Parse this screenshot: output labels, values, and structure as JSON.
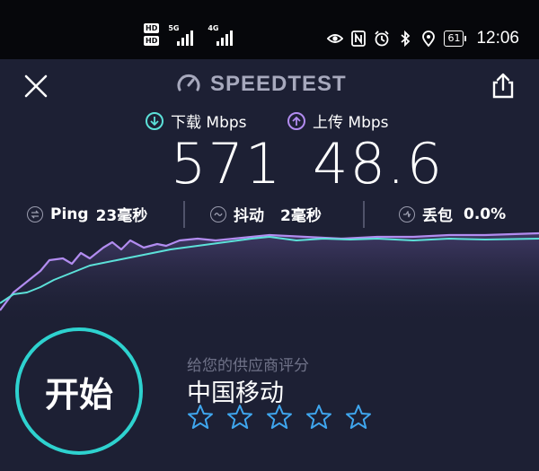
{
  "status_bar": {
    "hd_labels": [
      "HD",
      "HD"
    ],
    "network_labels": [
      "5G",
      "4G"
    ],
    "battery": "61",
    "time": "12:06",
    "icons": [
      "eye-icon",
      "nfc-icon",
      "alarm-icon",
      "bluetooth-icon",
      "location-icon"
    ]
  },
  "header": {
    "brand": "SPEEDTEST",
    "close_icon": "close-icon",
    "share_icon": "share-icon"
  },
  "results": {
    "download": {
      "label": "下载 Mbps",
      "value": "571",
      "color": "#5ce1d9"
    },
    "upload": {
      "label": "上传 Mbps",
      "value": "48.6",
      "color": "#b28cf0"
    }
  },
  "stats": {
    "ping": {
      "label": "Ping",
      "value": "23毫秒"
    },
    "jitter": {
      "label": "抖动",
      "value": "2毫秒"
    },
    "loss": {
      "label": "丢包",
      "value": "0.0%"
    }
  },
  "actions": {
    "start_label": "开始"
  },
  "rating": {
    "prompt": "给您的供应商评分",
    "provider": "中国移动",
    "stars_total": 5,
    "stars_filled": 0,
    "star_color": "#3fa6ee"
  },
  "colors": {
    "background": "#1d2034",
    "accent": "#2ed2cf",
    "download": "#5ce1d9",
    "upload": "#b28cf0"
  }
}
